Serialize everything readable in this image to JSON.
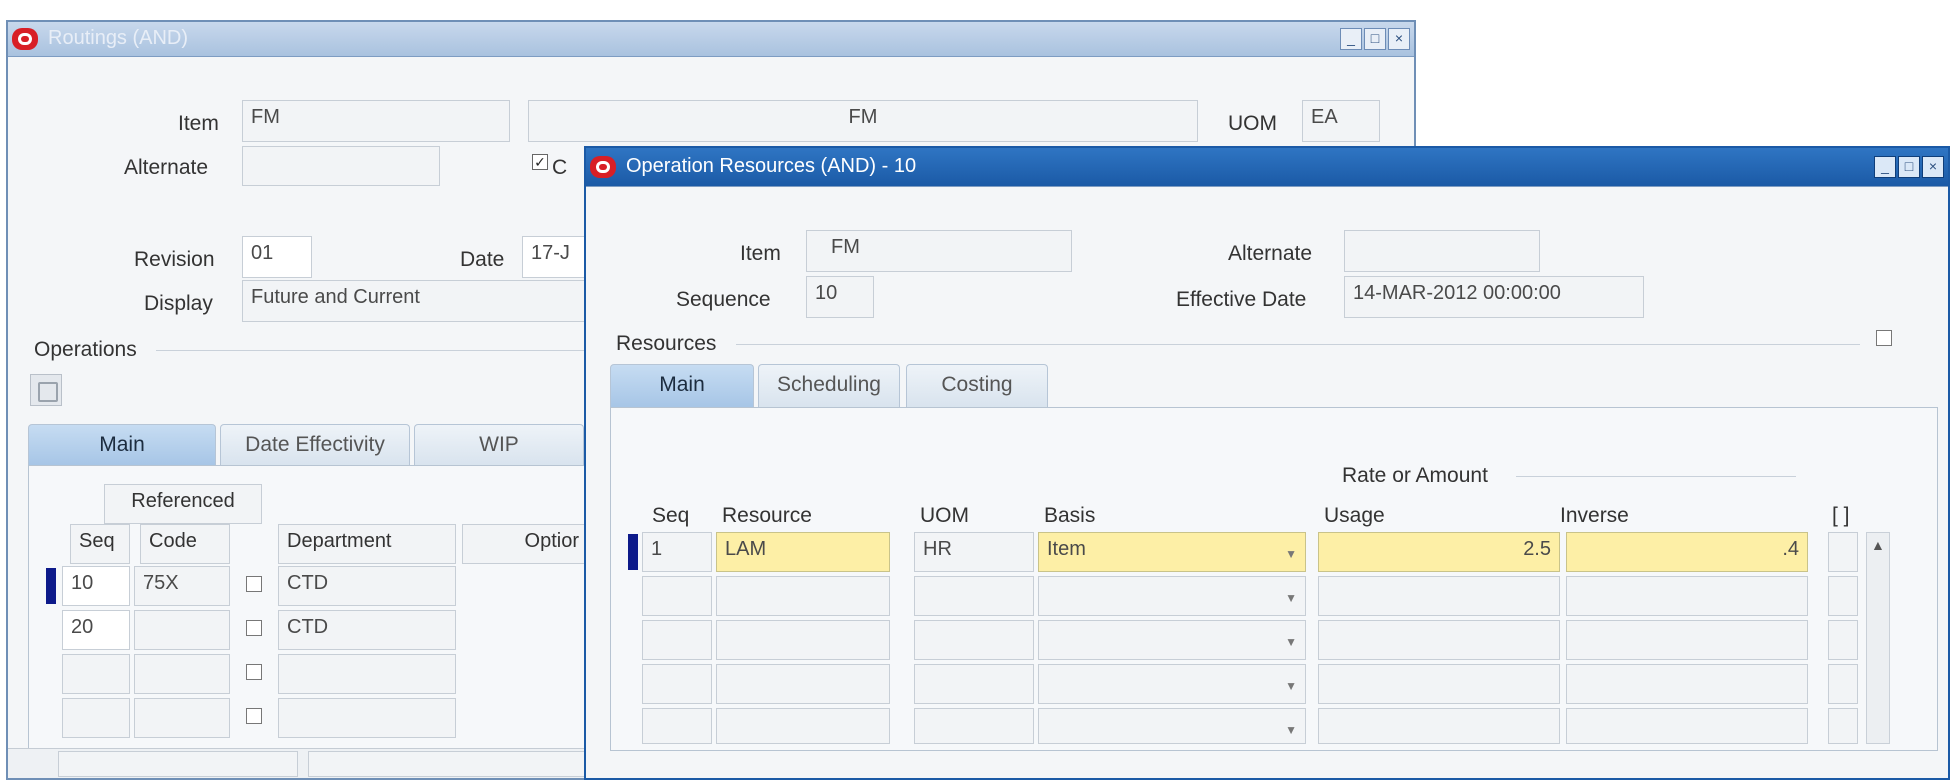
{
  "back_window": {
    "title": "Routings (AND)",
    "item_label": "Item",
    "item_value": "FM",
    "item_desc": "FM",
    "uom_label": "UOM",
    "uom_value": "EA",
    "alternate_label": "Alternate",
    "alternate_value": "",
    "revision_label": "Revision",
    "revision_value": "01",
    "date_label": "Date",
    "date_value": "17-J",
    "display_label": "Display",
    "display_value": "Future and Current",
    "operations_label": "Operations",
    "tabs": [
      "Main",
      "Date Effectivity",
      "WIP"
    ],
    "referenced_header": "Referenced",
    "col_seq": "Seq",
    "col_code": "Code",
    "col_department": "Department",
    "col_option": "Optior",
    "rows": [
      {
        "seq": "10",
        "code": "75X",
        "dept": "CTD"
      },
      {
        "seq": "20",
        "code": "",
        "dept": "CTD"
      },
      {
        "seq": "",
        "code": "",
        "dept": ""
      },
      {
        "seq": "",
        "code": "",
        "dept": ""
      }
    ]
  },
  "front_window": {
    "title": "Operation Resources (AND) - 10",
    "item_label": "Item",
    "item_value": "FM",
    "alternate_label": "Alternate",
    "alternate_value": "",
    "sequence_label": "Sequence",
    "sequence_value": "10",
    "effective_label": "Effective Date",
    "effective_value": "14-MAR-2012 00:00:00",
    "resources_label": "Resources",
    "tabs": [
      "Main",
      "Scheduling",
      "Costing"
    ],
    "rate_group": "Rate or Amount",
    "col_seq": "Seq",
    "col_resource": "Resource",
    "col_uom": "UOM",
    "col_basis": "Basis",
    "col_usage": "Usage",
    "col_inverse": "Inverse",
    "col_extra": "[ ]",
    "rows": [
      {
        "seq": "1",
        "resource": "LAM",
        "uom": "HR",
        "basis": "Item",
        "usage": "2.5",
        "inverse": ".4"
      }
    ]
  },
  "colors": {
    "active_title": "#1b5aa6",
    "inactive_title": "#a9c2df",
    "current_record": "#fdefa6",
    "record_marker": "#0d1a8a"
  }
}
